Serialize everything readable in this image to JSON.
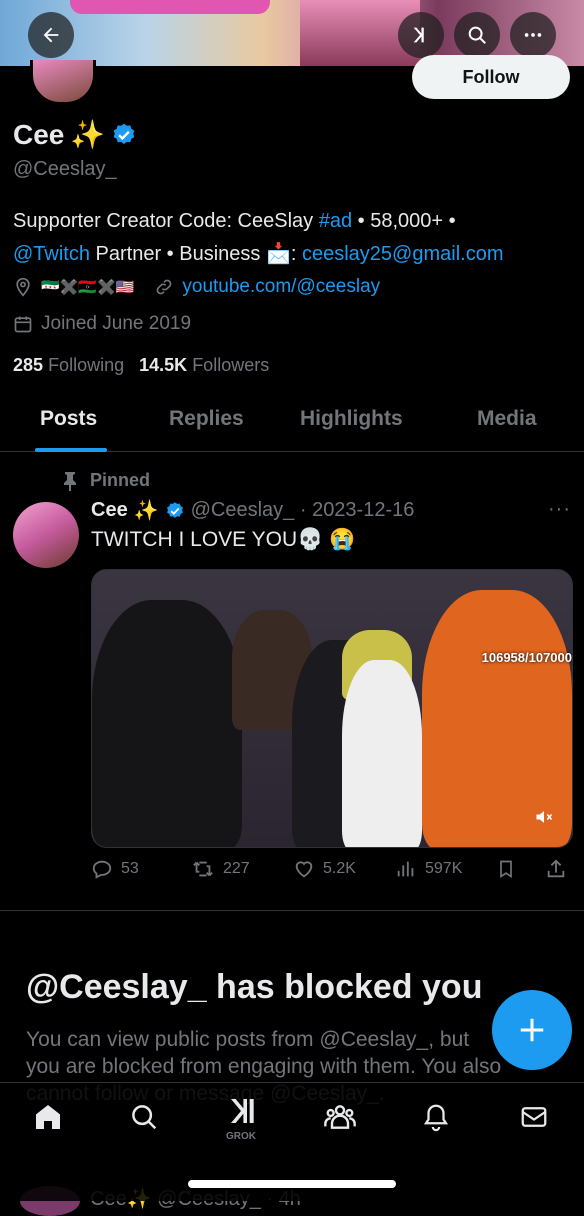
{
  "profile": {
    "name": "Cee",
    "sparkle": "✨",
    "handle": "@Ceeslay_",
    "follow_label": "Follow",
    "bio_line1_a": "Supporter Creator Code: CeeSlay ",
    "bio_hashtag": "#ad",
    "bio_line1_b": " • 58,000+ •",
    "bio_twitch": "@Twitch",
    "bio_line2_a": " Partner • Business ",
    "bio_mail_emoji": "📩",
    "bio_line2_b": ": ",
    "bio_email": "ceeslay25@gmail.com",
    "location_flags": "🇸🇾✖️🇱🇾✖️🇺🇸",
    "website": "youtube.com/@ceeslay",
    "joined": "Joined June 2019",
    "following_count": "285",
    "following_label": "Following",
    "followers_count": "14.5K",
    "followers_label": "Followers"
  },
  "tabs": [
    "Posts",
    "Replies",
    "Highlights",
    "Media"
  ],
  "post": {
    "pinned_label": "Pinned",
    "author_name": "Cee",
    "sparkle": "✨",
    "handle_date": "@Ceeslay_ · 2023-12-16",
    "text": "TWITCH I LOVE YOU💀 😭",
    "overlay_counter": "106958/107000",
    "replies": "53",
    "reposts": "227",
    "likes": "5.2K",
    "views": "597K"
  },
  "blocked": {
    "title": "@Ceeslay_ has blocked you",
    "body": "You can view public posts from @Ceeslay_, but you are blocked from engaging with them. You also cannot follow or message @Ceeslay_."
  },
  "nav": {
    "grok_label": "GROK"
  },
  "peek": {
    "text": "Cee✨ @Ceeslay_ · 4h"
  },
  "colors": {
    "accent": "#1d9bf0",
    "background": "#000000",
    "muted": "#71767b",
    "text": "#e7e9ea"
  }
}
